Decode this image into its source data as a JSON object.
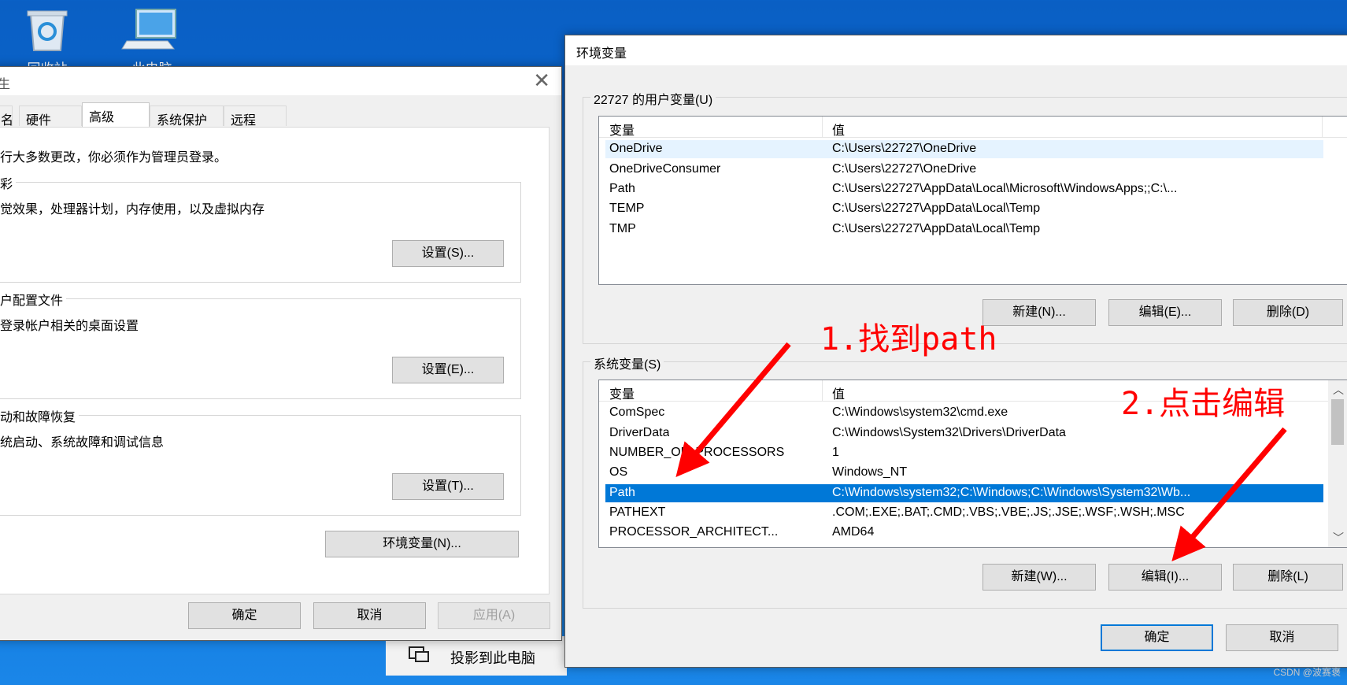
{
  "desktop": {
    "recycle_bin": "回收站",
    "this_pc": "此电脑"
  },
  "taskbar_popup": {
    "label": "投影到此电脑"
  },
  "sysprops": {
    "title_fragment": "生",
    "tabs": [
      "名",
      "硬件",
      "高级",
      "系统保护",
      "远程"
    ],
    "admin_note": "行大多数更改，你必须作为管理员登录。",
    "perf": {
      "title": "彩",
      "desc": "觉效果，处理器计划，内存使用，以及虚拟内存",
      "button": "设置(S)...",
      "mnemonic": "S"
    },
    "profiles": {
      "title": "户配置文件",
      "desc": "登录帐户相关的桌面设置",
      "button": "设置(E)...",
      "mnemonic": "E"
    },
    "startup": {
      "title": "动和故障恢复",
      "desc": "统启动、系统故障和调试信息",
      "button": "设置(T)...",
      "mnemonic": "T"
    },
    "env_button": "环境变量(N)...",
    "env_mnemonic": "N",
    "ok": "确定",
    "cancel": "取消",
    "apply": "应用(A)"
  },
  "envvars": {
    "title": "环境变量",
    "user_group": "22727 的用户变量(U)",
    "col_var": "变量",
    "col_val": "值",
    "user_vars": [
      {
        "name": "OneDrive",
        "value": "C:\\Users\\22727\\OneDrive"
      },
      {
        "name": "OneDriveConsumer",
        "value": "C:\\Users\\22727\\OneDrive"
      },
      {
        "name": "Path",
        "value": "C:\\Users\\22727\\AppData\\Local\\Microsoft\\WindowsApps;;C:\\..."
      },
      {
        "name": "TEMP",
        "value": "C:\\Users\\22727\\AppData\\Local\\Temp"
      },
      {
        "name": "TMP",
        "value": "C:\\Users\\22727\\AppData\\Local\\Temp"
      }
    ],
    "user_buttons": {
      "new": "新建(N)...",
      "edit": "编辑(E)...",
      "delete": "删除(D)"
    },
    "sys_group": "系统变量(S)",
    "sys_vars": [
      {
        "name": "ComSpec",
        "value": "C:\\Windows\\system32\\cmd.exe"
      },
      {
        "name": "DriverData",
        "value": "C:\\Windows\\System32\\Drivers\\DriverData"
      },
      {
        "name": "NUMBER_OF_PROCESSORS",
        "value": "1"
      },
      {
        "name": "OS",
        "value": "Windows_NT"
      },
      {
        "name": "Path",
        "value": "C:\\Windows\\system32;C:\\Windows;C:\\Windows\\System32\\Wb..."
      },
      {
        "name": "PATHEXT",
        "value": ".COM;.EXE;.BAT;.CMD;.VBS;.VBE;.JS;.JSE;.WSF;.WSH;.MSC"
      },
      {
        "name": "PROCESSOR_ARCHITECT...",
        "value": "AMD64"
      }
    ],
    "sys_buttons": {
      "new": "新建(W)...",
      "edit": "编辑(I)...",
      "delete": "删除(L)"
    },
    "ok": "确定",
    "cancel": "取消"
  },
  "annotations": {
    "step1": "1.找到path",
    "step2": "2.点击编辑"
  },
  "watermark": "CSDN @波赛褒",
  "colors": {
    "selection": "#0078d7",
    "annotation": "#ff0000",
    "desktop": "#0b6fd6"
  }
}
